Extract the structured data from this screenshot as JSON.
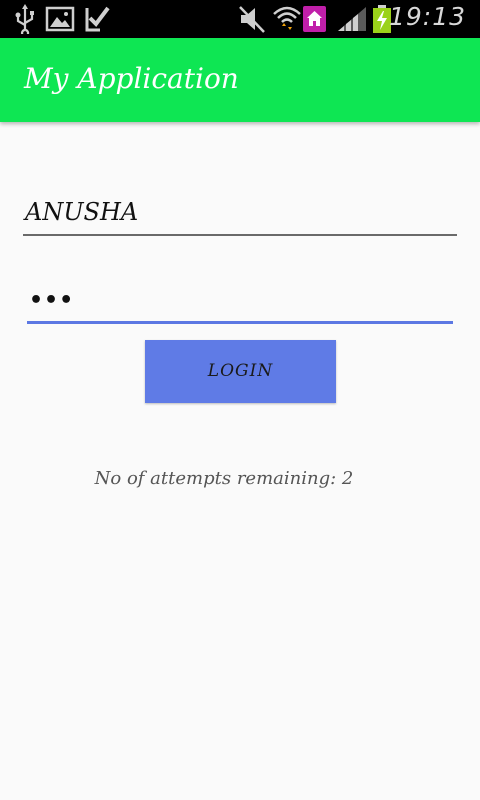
{
  "status_bar": {
    "time": "19:13",
    "icons": [
      "usb-icon",
      "gallery-icon",
      "download-done-icon",
      "mute-icon",
      "wifi-icon",
      "home-notification-icon",
      "signal-icon",
      "battery-charging-icon"
    ]
  },
  "app_bar": {
    "title": "My Application",
    "color": "#0ee653"
  },
  "form": {
    "username_value": "ANUSHA",
    "password_value": "•••",
    "login_label": "LOGIN",
    "login_color": "#5f7be6",
    "attempts_text": "No of attempts remaining: 2"
  }
}
